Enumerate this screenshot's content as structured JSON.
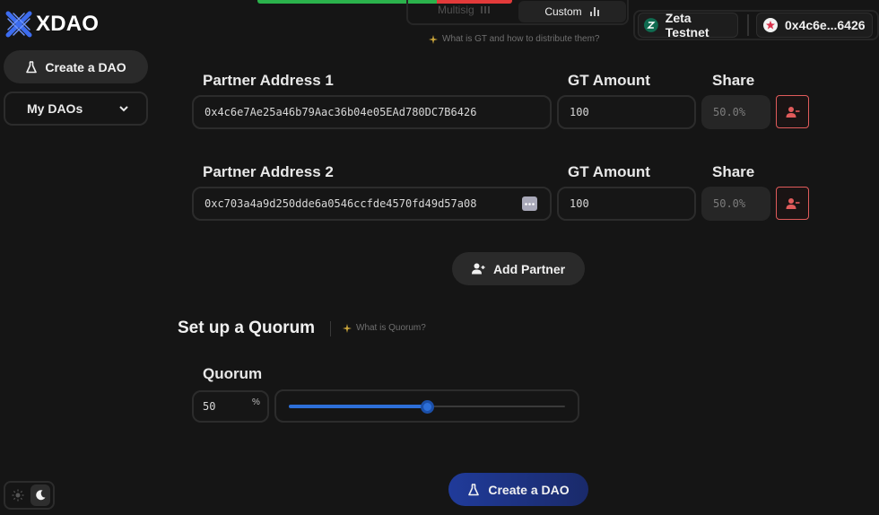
{
  "app": {
    "title": "XDAO"
  },
  "sidebar": {
    "create_label": "Create a DAO",
    "my_daos_label": "My DAOs"
  },
  "tabs": {
    "multisig": "Multisig",
    "custom": "Custom"
  },
  "hints": {
    "gt": "What is GT and how to distribute them?",
    "quorum": "What is Quorum?"
  },
  "header": {
    "network": "Zeta Testnet",
    "account": "0x4c6e...6426"
  },
  "partners": [
    {
      "address_label": "Partner Address 1",
      "address": "0x4c6e7Ae25a46b79Aac36b04e05EAd780DC7B6426",
      "amount_label": "GT Amount",
      "amount": "100",
      "share_label": "Share",
      "share": "50.0%"
    },
    {
      "address_label": "Partner Address 2",
      "address": "0xc703a4a9d250dde6a0546ccfde4570fd49d57a08",
      "amount_label": "GT Amount",
      "amount": "100",
      "share_label": "Share",
      "share": "50.0%"
    }
  ],
  "add_partner_label": "Add Partner",
  "quorum": {
    "section_title": "Set up a Quorum",
    "label": "Quorum",
    "value": "50",
    "unit": "%",
    "slider_fraction": 0.5
  },
  "create_button_label": "Create a DAO",
  "colors": {
    "accent": "#2d6fd8",
    "danger": "#e05b5b",
    "progress_green": "#2bb24c",
    "progress_red": "#e23a3a"
  }
}
